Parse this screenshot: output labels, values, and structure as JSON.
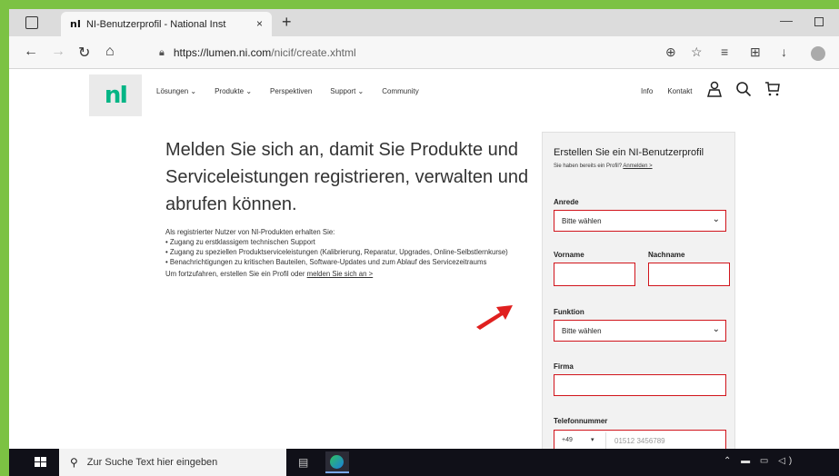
{
  "browser": {
    "tab_logo": "nI",
    "tab_title": "NI-Benutzerprofil - National Inst",
    "tab_close": "×",
    "new_tab": "+",
    "url_host": "https://lumen.ni.com",
    "url_path": "/nicif/create.xhtml"
  },
  "site": {
    "logo": "nI",
    "nav": [
      "Lösungen ⌄",
      "Produkte ⌄",
      "Perspektiven",
      "Support ⌄",
      "Community"
    ],
    "right_nav": {
      "info": "Info",
      "kontakt": "Kontakt"
    }
  },
  "content": {
    "headline": "Melden Sie sich an, damit Sie Produkte und Serviceleistungen registrieren, verwalten und abrufen können.",
    "intro": "Als registrierter Nutzer von NI-Produkten erhalten Sie:",
    "benefits": [
      "Zugang zu erstklassigem technischen Support",
      "Zugang zu speziellen Produktserviceleistungen (Kalibrierung, Reparatur, Upgrades, Online-Selbstlernkurse)",
      "Benachrichtigungen zu kritischen Bauteilen, Software-Updates und zum Ablauf des Servicezeitraums"
    ],
    "continue_text": "Um fortzufahren, erstellen Sie ein Profil oder",
    "continue_link": "melden Sie sich an >"
  },
  "form": {
    "title": "Erstellen Sie ein NI-Benutzerprofil",
    "subtitle": "Sie haben bereits ein Profil?",
    "login_link": "Anmelden >",
    "anrede_label": "Anrede",
    "anrede_value": "Bitte wählen",
    "vorname_label": "Vorname",
    "nachname_label": "Nachname",
    "funktion_label": "Funktion",
    "funktion_value": "Bitte wählen",
    "firma_label": "Firma",
    "telefon_label": "Telefonnummer",
    "telefon_code": "+49",
    "telefon_placeholder": "01512 3456789"
  },
  "taskbar": {
    "search_placeholder": "Zur Suche Text hier eingeben"
  },
  "colors": {
    "ni_green": "#03b585",
    "error_red": "#d1141b",
    "frame_green": "#7cc243",
    "arrow_red": "#e0201f"
  }
}
